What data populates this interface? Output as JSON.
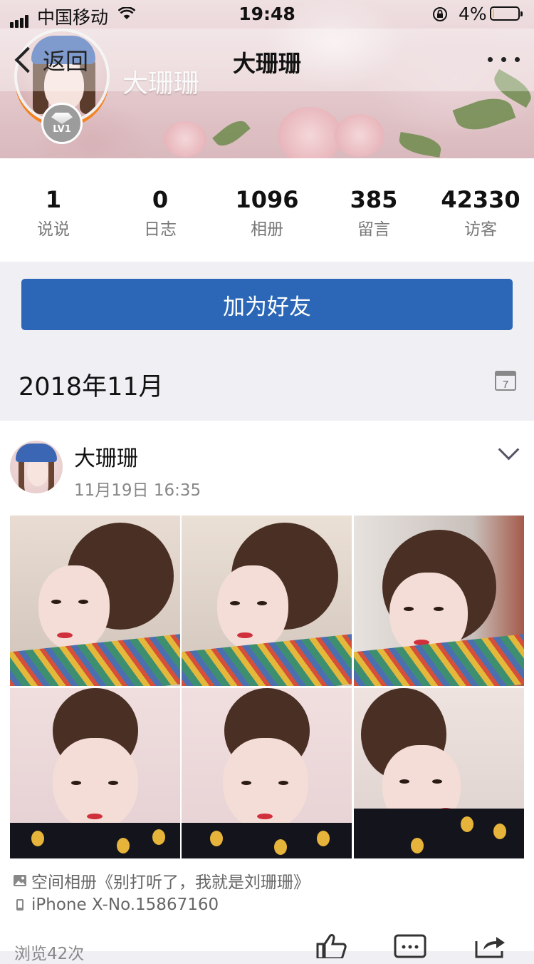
{
  "status_bar": {
    "carrier": "中国移动",
    "time": "19:48",
    "battery_pct": "4%",
    "battery_level": 0.04
  },
  "nav": {
    "back_label": "返回",
    "title": "大珊珊"
  },
  "profile": {
    "cover_name": "大珊珊",
    "level": "LV1"
  },
  "stats": [
    {
      "value": "1",
      "label": "说说"
    },
    {
      "value": "0",
      "label": "日志"
    },
    {
      "value": "1096",
      "label": "相册"
    },
    {
      "value": "385",
      "label": "留言"
    },
    {
      "value": "42330",
      "label": "访客"
    }
  ],
  "add_friend_label": "加为好友",
  "month": {
    "label": "2018年11月",
    "calendar_day": "7"
  },
  "post": {
    "author": "大珊珊",
    "time": "11月19日 16:35",
    "album_text": "空间相册《别打听了，我就是刘珊珊》",
    "device_text": "iPhone X-No.15867160",
    "views_text": "浏览42次"
  },
  "icons": {
    "back": "chevron-left-icon",
    "more": "more-dots-icon",
    "calendar": "calendar-icon",
    "expand": "chevron-down-icon",
    "album": "image-icon",
    "device": "phone-icon",
    "like": "thumbs-up-icon",
    "comment": "comment-icon",
    "share": "share-icon"
  },
  "colors": {
    "accent_blue": "#2b67b6",
    "level_ring": "#f58220",
    "battery_low": "#f3c52b"
  }
}
